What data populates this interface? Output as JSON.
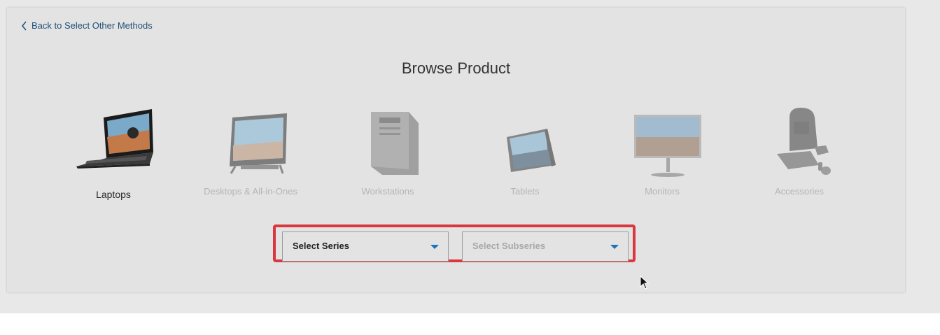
{
  "nav": {
    "back_label": "Back to Select Other Methods"
  },
  "page": {
    "title": "Browse Product"
  },
  "categories": [
    {
      "label": "Laptops",
      "icon": "laptop-icon",
      "active": true
    },
    {
      "label": "Desktops & All-in-Ones",
      "icon": "all-in-one-desktop-icon",
      "active": false
    },
    {
      "label": "Workstations",
      "icon": "workstation-tower-icon",
      "active": false
    },
    {
      "label": "Tablets",
      "icon": "tablet-icon",
      "active": false
    },
    {
      "label": "Monitors",
      "icon": "monitor-icon",
      "active": false
    },
    {
      "label": "Accessories",
      "icon": "accessories-icon",
      "active": false
    }
  ],
  "filters": {
    "series": {
      "value": "Select Series"
    },
    "subseries": {
      "value": "Select Subseries"
    }
  },
  "colors": {
    "link": "#1f4f7a",
    "highlight_border": "#d9383e",
    "caret": "#1d74b8"
  }
}
